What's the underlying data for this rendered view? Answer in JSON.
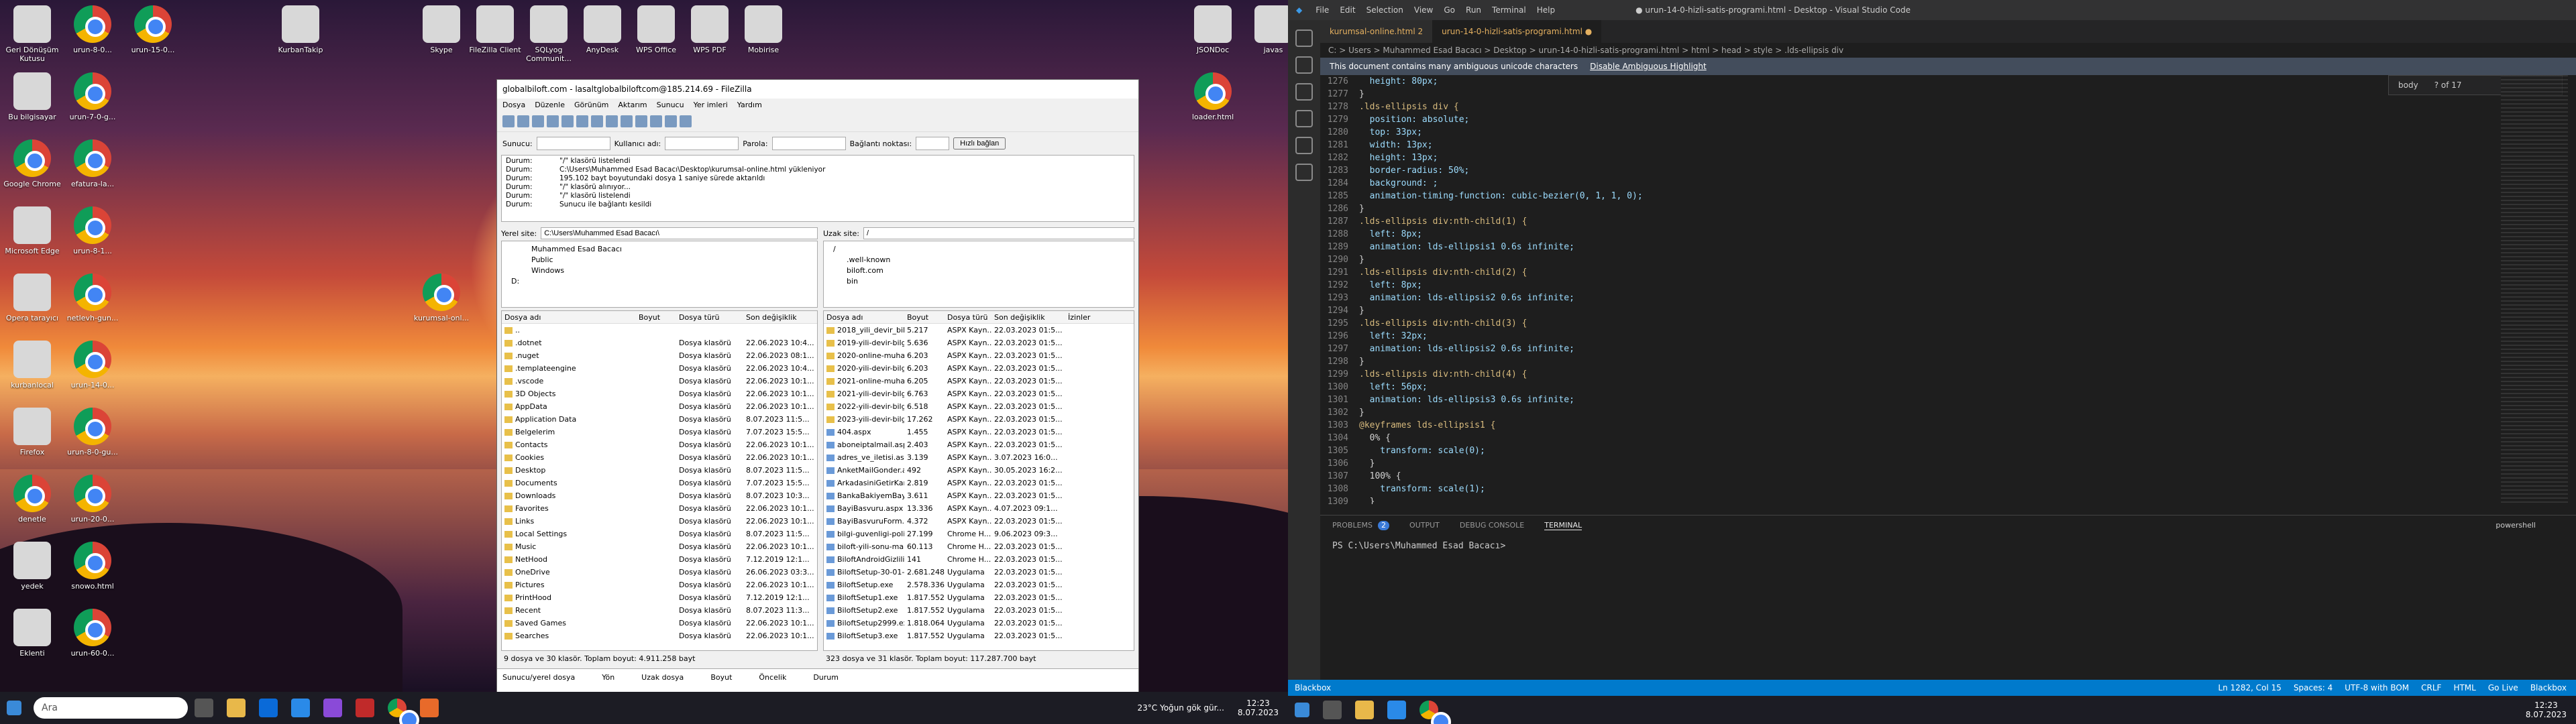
{
  "desktop": {
    "icons": [
      "Geri Dönüşüm Kutusu",
      "urun-8-0...",
      "urun-15-0...",
      "KurbanTakip",
      "Skype",
      "FileZilla Client",
      "SQLyog Communit...",
      "AnyDesk",
      "WPS Office",
      "WPS PDF",
      "Mobirise",
      "JSONDoc",
      "javas",
      "Bu bilgisayar",
      "urun-7-0-g...",
      "loader.html",
      "Google Chrome",
      "efatura-la...",
      "Microsoft Edge",
      "urun-8-1...",
      "Opera tarayıcı",
      "netlevh-gun...",
      "kurumsal-onl...",
      "kurbanlocal",
      "urun-14-0...",
      "Firefox",
      "urun-8-0-gu...",
      "denetle",
      "urun-20-0...",
      "yedek",
      "snowo.html",
      "Eklenti",
      "urun-60-0..."
    ]
  },
  "taskbar1": {
    "search": "Ara",
    "weather": "23°C  Yoğun gök gür...",
    "time": "12:23",
    "date": "8.07.2023"
  },
  "filezilla": {
    "title": "globalbiloft.com - lasaltglobalbiloftcom@185.214.69 - FileZilla",
    "menu": [
      "Dosya",
      "Düzenle",
      "Görünüm",
      "Aktarım",
      "Sunucu",
      "Yer imleri",
      "Yardım"
    ],
    "quick": {
      "host_label": "Sunucu:",
      "user_label": "Kullanıcı adı:",
      "pass_label": "Parola:",
      "port_label": "Bağlantı noktası:",
      "connect": "Hızlı bağlan"
    },
    "log": [
      [
        "Durum:",
        "\"/\" klasörü listelendi"
      ],
      [
        "Durum:",
        "C:\\Users\\Muhammed Esad Bacacı\\Desktop\\kurumsal-online.html yükleniyor"
      ],
      [
        "Durum:",
        "195.102 bayt boyutundaki dosya 1 saniye sürede aktarıldı"
      ],
      [
        "Durum:",
        "\"/\" klasörü alınıyor..."
      ],
      [
        "Durum:",
        "\"/\" klasörü listelendi"
      ],
      [
        "Durum:",
        "Sunucu ile bağlantı kesildi"
      ]
    ],
    "local_label": "Yerel site:",
    "local_path": "C:\\Users\\Muhammed Esad Bacacı\\",
    "remote_label": "Uzak site:",
    "remote_path": "/",
    "local_tree": [
      "Muhammed Esad Bacacı",
      "Public",
      "Windows",
      "D:"
    ],
    "remote_tree": [
      "/",
      ".well-known",
      "biloft.com",
      "bin"
    ],
    "local_headers": [
      "Dosya adı",
      "Boyut",
      "Dosya türü",
      "Son değişiklik"
    ],
    "remote_headers": [
      "Dosya adı",
      "Boyut",
      "Dosya türü",
      "Son değişiklik",
      "İzinler"
    ],
    "local_files": [
      [
        "..",
        "",
        "",
        ""
      ],
      [
        ".dotnet",
        "",
        "Dosya klasörü",
        "22.06.2023 10:4..."
      ],
      [
        ".nuget",
        "",
        "Dosya klasörü",
        "22.06.2023 08:1..."
      ],
      [
        ".templateengine",
        "",
        "Dosya klasörü",
        "22.06.2023 10:4..."
      ],
      [
        ".vscode",
        "",
        "Dosya klasörü",
        "22.06.2023 10:1..."
      ],
      [
        "3D Objects",
        "",
        "Dosya klasörü",
        "22.06.2023 10:1..."
      ],
      [
        "AppData",
        "",
        "Dosya klasörü",
        "22.06.2023 10:1..."
      ],
      [
        "Application Data",
        "",
        "Dosya klasörü",
        "8.07.2023 11:5..."
      ],
      [
        "Belgelerim",
        "",
        "Dosya klasörü",
        "7.07.2023 15:5..."
      ],
      [
        "Contacts",
        "",
        "Dosya klasörü",
        "22.06.2023 10:1..."
      ],
      [
        "Cookies",
        "",
        "Dosya klasörü",
        "22.06.2023 10:1..."
      ],
      [
        "Desktop",
        "",
        "Dosya klasörü",
        "8.07.2023 11:5..."
      ],
      [
        "Documents",
        "",
        "Dosya klasörü",
        "7.07.2023 15:5..."
      ],
      [
        "Downloads",
        "",
        "Dosya klasörü",
        "8.07.2023 10:3..."
      ],
      [
        "Favorites",
        "",
        "Dosya klasörü",
        "22.06.2023 10:1..."
      ],
      [
        "Links",
        "",
        "Dosya klasörü",
        "22.06.2023 10:1..."
      ],
      [
        "Local Settings",
        "",
        "Dosya klasörü",
        "8.07.2023 11:5..."
      ],
      [
        "Music",
        "",
        "Dosya klasörü",
        "22.06.2023 10:1..."
      ],
      [
        "NetHood",
        "",
        "Dosya klasörü",
        "7.12.2019 12:1..."
      ],
      [
        "OneDrive",
        "",
        "Dosya klasörü",
        "26.06.2023 03:3..."
      ],
      [
        "Pictures",
        "",
        "Dosya klasörü",
        "22.06.2023 10:1..."
      ],
      [
        "PrintHood",
        "",
        "Dosya klasörü",
        "7.12.2019 12:1..."
      ],
      [
        "Recent",
        "",
        "Dosya klasörü",
        "8.07.2023 11:3..."
      ],
      [
        "Saved Games",
        "",
        "Dosya klasörü",
        "22.06.2023 10:1..."
      ],
      [
        "Searches",
        "",
        "Dosya klasörü",
        "22.06.2023 10:1..."
      ]
    ],
    "remote_files": [
      [
        "2018_yili_devir_bilgi.as...",
        "5.217",
        "ASPX Kayn...",
        "22.03.2023 01:5..."
      ],
      [
        "2019-yili-devir-bilgi.as...",
        "5.636",
        "ASPX Kayn...",
        "22.03.2023 01:5..."
      ],
      [
        "2020-online-muhaseb...",
        "6.203",
        "ASPX Kayn...",
        "22.03.2023 01:5..."
      ],
      [
        "2020-yili-devir-bilgi.as...",
        "6.203",
        "ASPX Kayn...",
        "22.03.2023 01:5..."
      ],
      [
        "2021-online-muhaseb...",
        "6.205",
        "ASPX Kayn...",
        "22.03.2023 01:5..."
      ],
      [
        "2021-yili-devir-bilgi.as...",
        "6.763",
        "ASPX Kayn...",
        "22.03.2023 01:5..."
      ],
      [
        "2022-yili-devir-bilgi.as...",
        "6.518",
        "ASPX Kayn...",
        "22.03.2023 01:5..."
      ],
      [
        "2023-yili-devir-bilgi.as...",
        "17.262",
        "ASPX Kayn...",
        "22.03.2023 01:5..."
      ],
      [
        "404.aspx",
        "1.455",
        "ASPX Kayn...",
        "22.03.2023 01:5..."
      ],
      [
        "aboneiptalmail.aspx",
        "2.403",
        "ASPX Kayn...",
        "22.03.2023 01:5..."
      ],
      [
        "adres_ve_iletisi.aspx",
        "3.139",
        "ASPX Kayn...",
        "3.07.2023 16:0..."
      ],
      [
        "AnketMailGonder.aspx",
        "492",
        "ASPX Kayn...",
        "30.05.2023 16:2..."
      ],
      [
        "ArkadasiniGetirKampa...",
        "2.819",
        "ASPX Kayn...",
        "22.03.2023 01:5..."
      ],
      [
        "BankaBakiyemBaysur...",
        "3.611",
        "ASPX Kayn...",
        "22.03.2023 01:5..."
      ],
      [
        "BayiBasvuru.aspx",
        "13.336",
        "ASPX Kayn...",
        "4.07.2023 09:1..."
      ],
      [
        "BayiBasvuruForm.aspx",
        "4.372",
        "ASPX Kayn...",
        "22.03.2023 01:5..."
      ],
      [
        "bilgi-guvenligi-politik...",
        "27.199",
        "Chrome H...",
        "9.06.2023 09:3..."
      ],
      [
        "biloft-yili-sonu-mail...",
        "60.113",
        "Chrome H...",
        "22.03.2023 01:5..."
      ],
      [
        "BiloftAndroidGizlilikP...",
        "141",
        "Chrome H...",
        "22.03.2023 01:5..."
      ],
      [
        "BiloftSetup-30-01-20...",
        "2.681.248",
        "Uygulama",
        "22.03.2023 01:5..."
      ],
      [
        "BiloftSetup.exe",
        "2.578.336",
        "Uygulama",
        "22.03.2023 01:5..."
      ],
      [
        "BiloftSetup1.exe",
        "1.817.552",
        "Uygulama",
        "22.03.2023 01:5..."
      ],
      [
        "BiloftSetup2.exe",
        "1.817.552",
        "Uygulama",
        "22.03.2023 01:5..."
      ],
      [
        "BiloftSetup2999.exe",
        "1.818.064",
        "Uygulama",
        "22.03.2023 01:5..."
      ],
      [
        "BiloftSetup3.exe",
        "1.817.552",
        "Uygulama",
        "22.03.2023 01:5..."
      ]
    ],
    "local_status": "9 dosya ve 30 klasör. Toplam boyut: 4.911.258 bayt",
    "remote_status": "323 dosya ve 31 klasör. Toplam boyut: 117.287.700 bayt",
    "queue": [
      "Sunucu/yerel dosya",
      "Yön",
      "Uzak dosya",
      "Boyut",
      "Öncelik",
      "Durum"
    ]
  },
  "vscode": {
    "title": "● urun-14-0-hizli-satis-programi.html - Desktop - Visual Studio Code",
    "menu": [
      "File",
      "Edit",
      "Selection",
      "View",
      "Go",
      "Run",
      "Terminal",
      "Help"
    ],
    "tabs": [
      "kurumsal-online.html 2",
      "urun-14-0-hizli-satis-programi.html ●"
    ],
    "breadcrumb": "C: > Users > Muhammed Esad Bacacı > Desktop > urun-14-0-hizli-satis-programi.html > html > head > style > .lds-ellipsis div",
    "banner": "This document contains many ambiguous unicode characters",
    "banner_link": "Disable Ambiguous Highlight",
    "find_text": "body",
    "find_count": "? of 17",
    "code": [
      [
        "1276",
        "  height: 80px;"
      ],
      [
        "1277",
        "}"
      ],
      [
        "1278",
        ".lds-ellipsis div {"
      ],
      [
        "1279",
        "  position: absolute;"
      ],
      [
        "1280",
        "  top: 33px;"
      ],
      [
        "1281",
        "  width: 13px;"
      ],
      [
        "1282",
        "  height: 13px;"
      ],
      [
        "1283",
        "  border-radius: 50%;"
      ],
      [
        "1284",
        "  background: ;"
      ],
      [
        "1285",
        "  animation-timing-function: cubic-bezier(0, 1, 1, 0);"
      ],
      [
        "1286",
        "}"
      ],
      [
        "1287",
        ".lds-ellipsis div:nth-child(1) {"
      ],
      [
        "1288",
        "  left: 8px;"
      ],
      [
        "1289",
        "  animation: lds-ellipsis1 0.6s infinite;"
      ],
      [
        "1290",
        "}"
      ],
      [
        "1291",
        ".lds-ellipsis div:nth-child(2) {"
      ],
      [
        "1292",
        "  left: 8px;"
      ],
      [
        "1293",
        "  animation: lds-ellipsis2 0.6s infinite;"
      ],
      [
        "1294",
        "}"
      ],
      [
        "1295",
        ".lds-ellipsis div:nth-child(3) {"
      ],
      [
        "1296",
        "  left: 32px;"
      ],
      [
        "1297",
        "  animation: lds-ellipsis2 0.6s infinite;"
      ],
      [
        "1298",
        "}"
      ],
      [
        "1299",
        ".lds-ellipsis div:nth-child(4) {"
      ],
      [
        "1300",
        "  left: 56px;"
      ],
      [
        "1301",
        "  animation: lds-ellipsis3 0.6s infinite;"
      ],
      [
        "1302",
        "}"
      ],
      [
        "1303",
        "@keyframes lds-ellipsis1 {"
      ],
      [
        "1304",
        "  0% {"
      ],
      [
        "1305",
        "    transform: scale(0);"
      ],
      [
        "1306",
        "  }"
      ],
      [
        "1307",
        "  100% {"
      ],
      [
        "1308",
        "    transform: scale(1);"
      ],
      [
        "1309",
        "  }"
      ]
    ],
    "panel_tabs": [
      "PROBLEMS",
      "OUTPUT",
      "DEBUG CONSOLE",
      "TERMINAL"
    ],
    "problems_count": "2",
    "terminal_name": "powershell",
    "prompt": "PS C:\\Users\\Muhammed Esad Bacacı>",
    "status_left": "Blackbox",
    "status_right": [
      "Ln 1282, Col 15",
      "Spaces: 4",
      "UTF-8 with BOM",
      "CRLF",
      "HTML",
      "Go Live",
      "Blackbox"
    ],
    "time": "12:23",
    "date": "8.07.2023"
  }
}
